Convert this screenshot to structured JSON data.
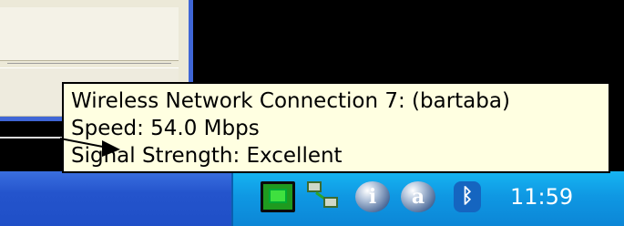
{
  "tooltip": {
    "title": "Wireless Network Connection 7: (bartaba)",
    "speed": "Speed: 54.0 Mbps",
    "signal": "Signal Strength: Excellent"
  },
  "tray": {
    "icons": [
      "monitor-icon",
      "network-icon",
      "info-icon",
      "a-icon",
      "bluetooth-icon"
    ],
    "info_glyph": "i",
    "a_glyph": "a",
    "bluetooth_glyph": "ᛒ",
    "clock": "11:59"
  },
  "colors": {
    "taskbar_blue": "#2454cc",
    "tray_blue": "#0f98e3",
    "tooltip_bg": "#ffffe1"
  }
}
